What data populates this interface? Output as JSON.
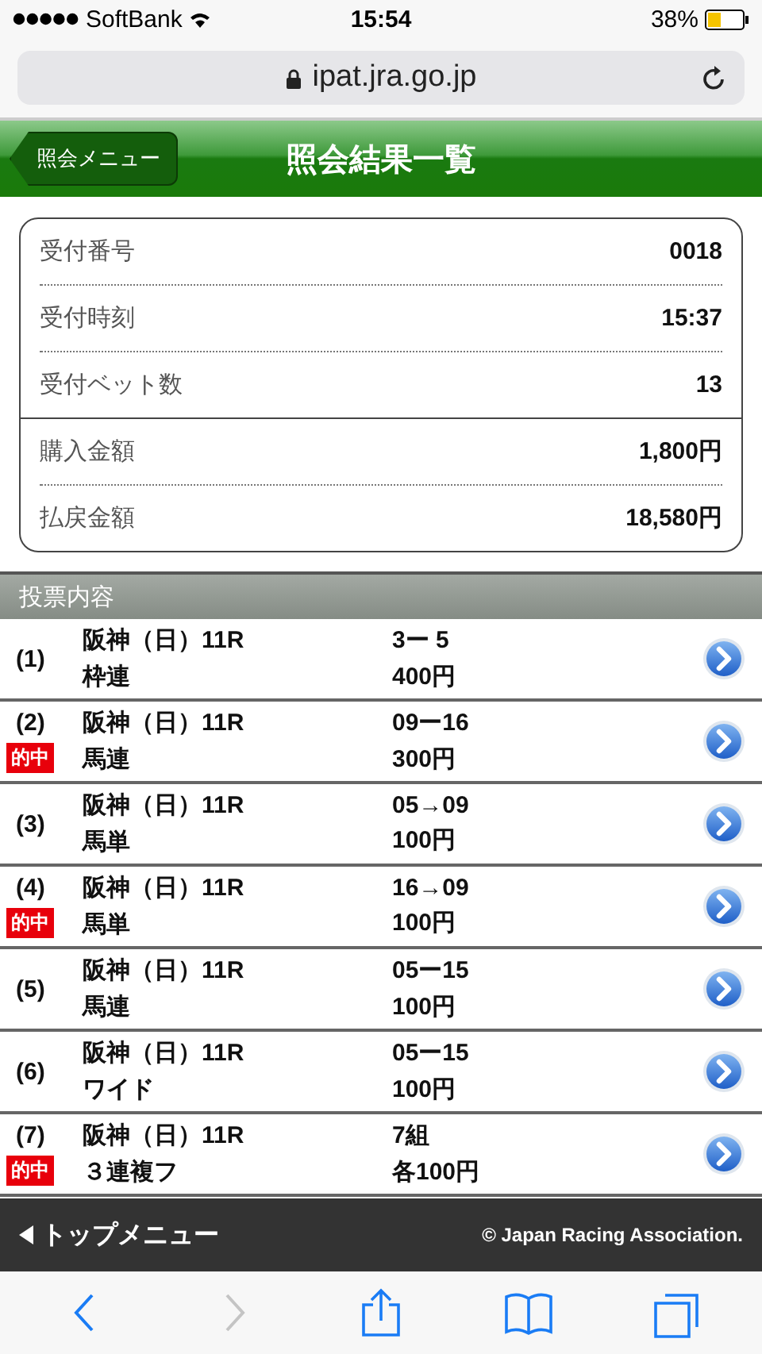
{
  "status_bar": {
    "carrier": "SoftBank",
    "time": "15:54",
    "battery": "38%"
  },
  "address_bar": {
    "url": "ipat.jra.go.jp"
  },
  "header": {
    "back_button": "照会メニュー",
    "title": "照会結果一覧"
  },
  "summary": [
    [
      {
        "label": "受付番号",
        "value": "0018"
      },
      {
        "label": "受付時刻",
        "value": "15:37"
      },
      {
        "label": "受付ベット数",
        "value": "13"
      }
    ],
    [
      {
        "label": "購入金額",
        "value": "1,800円"
      },
      {
        "label": "払戻金額",
        "value": "18,580円"
      }
    ]
  ],
  "section_title": "投票内容",
  "bets": [
    {
      "number": "(1)",
      "race": "阪神（日）11R",
      "type": "枠連",
      "combination": "3ー 5",
      "amount": "400円"
    },
    {
      "number": "(2)",
      "race": "阪神（日）11R",
      "type": "馬連",
      "combination": "09ー16",
      "amount": "300円",
      "badge": "的中"
    },
    {
      "number": "(3)",
      "race": "阪神（日）11R",
      "type": "馬単",
      "combination": "05→09",
      "amount": "100円"
    },
    {
      "number": "(4)",
      "race": "阪神（日）11R",
      "type": "馬単",
      "combination": "16→09",
      "amount": "100円",
      "badge": "的中"
    },
    {
      "number": "(5)",
      "race": "阪神（日）11R",
      "type": "馬連",
      "combination": "05ー15",
      "amount": "100円"
    },
    {
      "number": "(6)",
      "race": "阪神（日）11R",
      "type": "ワイド",
      "combination": "05ー15",
      "amount": "100円"
    },
    {
      "number": "(7)",
      "race": "阪神（日）11R",
      "type": "３連複フ",
      "combination": "7組",
      "amount": "各100円",
      "badge": "的中"
    }
  ],
  "footer": {
    "top_menu": "トップメニュー",
    "copyright": "© Japan Racing Association."
  },
  "toolbar": [
    {
      "kind": "back",
      "disabled": false
    },
    {
      "kind": "forward",
      "disabled": true
    },
    {
      "kind": "share",
      "disabled": false
    },
    {
      "kind": "bookmarks",
      "disabled": false
    },
    {
      "kind": "tabs",
      "disabled": false
    }
  ]
}
